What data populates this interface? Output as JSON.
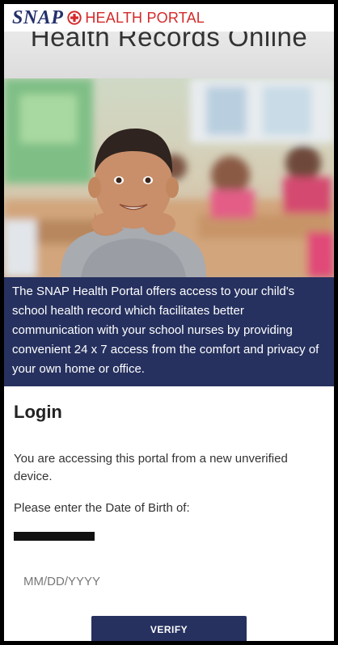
{
  "header": {
    "brand_snap": "SNAP",
    "brand_portal": "HEALTH PORTAL",
    "subtitle": "Health Records Online"
  },
  "colors": {
    "brand_navy": "#23306b",
    "brand_red": "#d42a2a",
    "intro_background": "#26315f"
  },
  "intro": {
    "text": "The SNAP Health Portal offers access to your child's school health record which facilitates better communication with your school nurses by providing convenient 24 x 7 access from the comfort and privacy of your own home or office."
  },
  "login": {
    "title": "Login",
    "message": "You are accessing this portal from a new unverified device.",
    "dob_prompt": "Please enter the Date of Birth of:",
    "dob_placeholder": "MM/DD/YYYY",
    "verify_label": "VERIFY"
  },
  "icons": {
    "logo": "red-cross-circle-icon"
  }
}
